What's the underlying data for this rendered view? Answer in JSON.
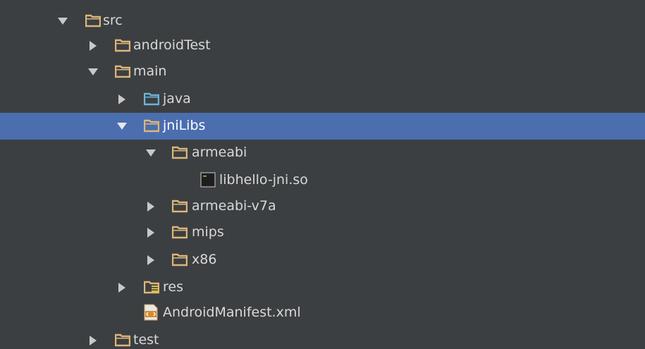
{
  "project_tree": {
    "items": [
      {
        "label": "src",
        "expanded": true,
        "icon": "folder-icon"
      },
      {
        "label": "androidTest",
        "expanded": false,
        "icon": "folder-icon"
      },
      {
        "label": "main",
        "expanded": true,
        "icon": "folder-icon"
      },
      {
        "label": "java",
        "expanded": false,
        "icon": "source-folder-icon"
      },
      {
        "label": "jniLibs",
        "expanded": true,
        "icon": "folder-icon",
        "selected": true
      },
      {
        "label": "armeabi",
        "expanded": true,
        "icon": "folder-icon"
      },
      {
        "label": "libhello-jni.so",
        "icon": "binary-file-icon"
      },
      {
        "label": "armeabi-v7a",
        "expanded": false,
        "icon": "folder-icon"
      },
      {
        "label": "mips",
        "expanded": false,
        "icon": "folder-icon"
      },
      {
        "label": "x86",
        "expanded": false,
        "icon": "folder-icon"
      },
      {
        "label": "res",
        "expanded": false,
        "icon": "resource-folder-icon"
      },
      {
        "label": "AndroidManifest.xml",
        "icon": "manifest-file-icon"
      },
      {
        "label": "test",
        "expanded": false,
        "icon": "folder-icon"
      }
    ]
  },
  "colors": {
    "background": "#3c3f41",
    "selection": "#4b6eaf",
    "folder": "#dcb67a",
    "source_folder": "#6cb4d8",
    "text": "#d8d8d8"
  }
}
